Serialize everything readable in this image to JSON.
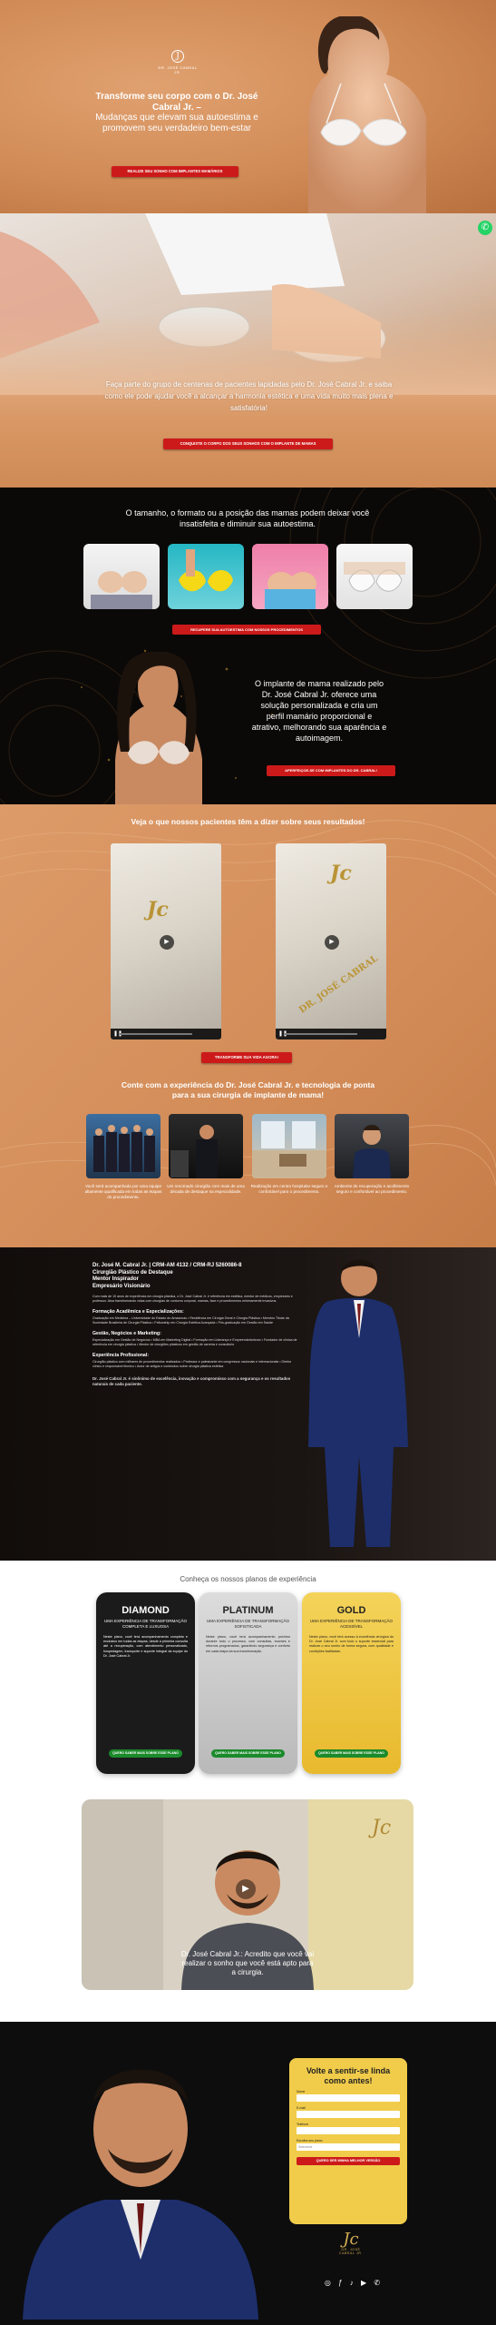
{
  "hero": {
    "logo_mark": "J",
    "logo_name": "DR. JOSÉ CABRAL JR.",
    "title": "Transforme seu corpo com o Dr. José Cabral Jr. –",
    "subtitle": "Mudanças que elevam sua autoestima e promovem seu verdadeiro bem-estar",
    "cta": "REALIZE SEU SONHO COM IMPLANTES MAMÁRIOS"
  },
  "whatsapp_icon": "whatsapp-icon",
  "clinic": {
    "text": "Faça parte do grupo de centenas de pacientes lapidadas pelo Dr. José Cabral Jr. e saiba como ele pode ajudar você a alcançar a harmonia estética e uma vida muito mais plena e satisfatória!",
    "cta": "CONQUISTE O CORPO DOS SEUS SONHOS COM O IMPLANTE DE MAMAS"
  },
  "shape": {
    "title": "O tamanho, o formato ou a posição das mamas podem deixar você insatisfeita e diminuir sua autoestima.",
    "cta1": "RECUPERE SUA AUTOESTIMA COM NOSSOS PROCEDIMENTOS",
    "text2": "O implante de mama realizado pelo Dr. José Cabral Jr. oferece uma solução personalizada e cria um perfil mamário proporcional e atrativo, melhorando sua aparência e autoimagem.",
    "cta2": "APERFEIÇOE-SE COM IMPLANTES DO DR. CABRAL!"
  },
  "results": {
    "title": "Veja o que nossos pacientes têm a dizer sobre seus resultados!",
    "videos": [
      {
        "stitch": "Jc"
      },
      {
        "stitch": "Jc",
        "stitch2": "DR. JOSÉ CABRAL"
      }
    ],
    "cta": "TRANSFORME SUA VIDA AGORA!",
    "experience_title": "Conte com a experiência do Dr. José Cabral Jr. e tecnologia de ponta para a sua cirurgia de implante de mama!",
    "thumbs": [
      {
        "caption": "Você será acompanhada por uma equipe altamente qualificada em todas as etapas do procedimento."
      },
      {
        "caption": "Um renomado cirurgião com mais de uma década de destaque na especialidade."
      },
      {
        "caption": "Realização em centro hospitalar seguro e confortável para o procedimento."
      },
      {
        "caption": "Ambiente de recuperação e acolhimento seguro e confortável ao procedimento."
      }
    ]
  },
  "bio": {
    "name": "Dr. José M. Cabral Jr. | CRM-AM 4132 / CRM-RJ 5260086-8",
    "line1": "Cirurgião Plástico de Destaque",
    "line2": "Mentor Inspirador",
    "line3": "Empresário Visionário",
    "intro": "Com mais de 10 anos de experiência em cirurgia plástica, o Dr. José Cabral Jr. é referência em estética, mentor de médicos, empresário e professor. Atua transformando vidas com cirurgias de contorno corporal, mamas, face e procedimentos minimamente invasivos.",
    "h_formacao": "Formação Acadêmica e Especializações:",
    "formacao": "Graduação em Medicina – Universidade do Estado do Amazonas • Residência em Cirurgia Geral e Cirurgia Plástica • Membro Titular da Sociedade Brasileira de Cirurgia Plástica • Fellowship em Cirurgia Estética Avançada • Pós-graduação em Gestão em Saúde",
    "h_gestao": "Gestão, Negócios e Marketing:",
    "gestao": "Especialização em Gestão de Negócios • MBA em Marketing Digital • Formação em Liderança e Empreendedorismo • Fundador de clínica de referência em cirurgia plástica • Mentor de cirurgiões plásticos em gestão de carreira e consultório",
    "h_exp": "Experiência Profissional:",
    "exp": "Cirurgião plástico com milhares de procedimentos realizados • Professor e palestrante em congressos nacionais e internacionais • Diretor clínico e responsável técnico • Autor de artigos e conteúdos sobre cirurgia plástica estética",
    "closing": "Dr. José Cabral Jr. é sinônimo de excelência, inovação e compromisso com a segurança e os resultados naturais de cada paciente."
  },
  "plans": {
    "title": "Conheça os nossos planos de experiência",
    "items": [
      {
        "name": "DIAMOND",
        "subtitle": "UMA EXPERIÊNCIA DE TRANSFORMAÇÃO COMPLETA E LUXUOSA",
        "desc": "Neste plano, você terá acompanhamento completo e exclusivo em todas as etapas, desde a primeira consulta até a recuperação, com atendimento personalizado, hospedagem, transporte e suporte integral da equipe do Dr. José Cabral Jr.",
        "cta": "QUERO SABER MAIS SOBRE ESSE PLANO"
      },
      {
        "name": "PLATINUM",
        "subtitle": "UMA EXPERIÊNCIA DE TRANSFORMAÇÃO SOFISTICADA",
        "desc": "Neste plano, você terá acompanhamento próximo durante todo o processo, com consultas, exames e retornos programados, garantindo segurança e conforto em cada etapa da sua transformação.",
        "cta": "QUERO SABER MAIS SOBRE ESSE PLANO"
      },
      {
        "name": "GOLD",
        "subtitle": "UMA EXPERIÊNCIA DE TRANSFORMAÇÃO ACESSÍVEL",
        "desc": "Neste plano, você terá acesso à excelência cirúrgica do Dr. José Cabral Jr. com todo o suporte essencial para realizar o seu sonho de forma segura, com qualidade e condições facilitadas.",
        "cta": "QUERO SABER MAIS SOBRE ESSE PLANO"
      }
    ],
    "video_caption": "Dr. José Cabral Jr.: Acredito que você vai realizar o sonho que você está apto para a cirurgia."
  },
  "contact": {
    "form_title": "Volte a sentir-se linda como antes!",
    "fields": [
      {
        "label": "Nome",
        "placeholder": ""
      },
      {
        "label": "E-mail",
        "placeholder": ""
      },
      {
        "label": "Telefone",
        "placeholder": ""
      },
      {
        "label": "Escolha seu plano",
        "placeholder": "Selecione"
      }
    ],
    "submit": "QUERO SER MINHA MELHOR VERSÃO",
    "footer_logo_mark": "Jc",
    "footer_logo_name": "DR. JOSÉ CABRAL JR.",
    "socials": [
      "instagram-icon",
      "facebook-icon",
      "tiktok-icon",
      "youtube-icon",
      "whatsapp-icon"
    ]
  },
  "colors": {
    "accent_red": "#cc1a1a",
    "brand_orange": "#d99866",
    "gold": "#f1cc4a",
    "green_button": "#1b8a2b"
  }
}
